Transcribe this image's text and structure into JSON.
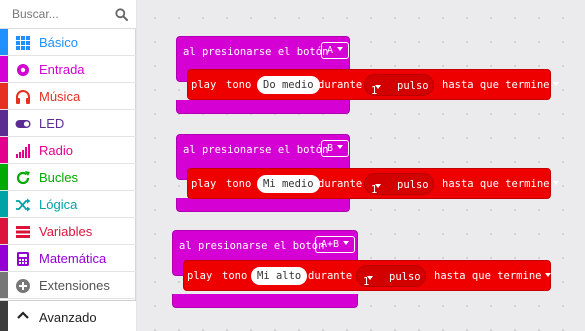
{
  "search": {
    "placeholder": "Buscar..."
  },
  "toolbox": {
    "categories": [
      {
        "label": "Básico",
        "color": "#1e90ff",
        "icon": "grid-icon"
      },
      {
        "label": "Entrada",
        "color": "#d400d4",
        "icon": "circle-icon"
      },
      {
        "label": "Música",
        "color": "#e63022",
        "icon": "headphones-icon"
      },
      {
        "label": "LED",
        "color": "#5c2d91",
        "icon": "toggle-icon"
      },
      {
        "label": "Radio",
        "color": "#e3008c",
        "icon": "signal-bars-icon"
      },
      {
        "label": "Bucles",
        "color": "#00aa00",
        "icon": "refresh-icon"
      },
      {
        "label": "Lógica",
        "color": "#00a4a6",
        "icon": "shuffle-icon"
      },
      {
        "label": "Variables",
        "color": "#dc143c",
        "icon": "list-icon"
      },
      {
        "label": "Matemática",
        "color": "#9400d3",
        "icon": "calculator-icon"
      },
      {
        "label": "Extensiones",
        "color": "#777777",
        "icon": "plus-circle-icon"
      }
    ],
    "advanced": {
      "label": "Avanzado",
      "icon": "chevron-up-icon"
    }
  },
  "blocks": [
    {
      "event_label": "al presionarse el botón",
      "button": "A",
      "play": "play",
      "tone": "tono",
      "note": "Do medio",
      "during": "durante",
      "beats": "1",
      "pulse": "pulso",
      "mode": "hasta que termine"
    },
    {
      "event_label": "al presionarse el botón",
      "button": "B",
      "play": "play",
      "tone": "tono",
      "note": "Mi medio",
      "during": "durante",
      "beats": "1",
      "pulse": "pulso",
      "mode": "hasta que termine"
    },
    {
      "event_label": "al presionarse el botón",
      "button": "A+B",
      "play": "play",
      "tone": "tono",
      "note": "Mi alto",
      "during": "durante",
      "beats": "1",
      "pulse": "pulso",
      "mode": "hasta que termine"
    }
  ]
}
